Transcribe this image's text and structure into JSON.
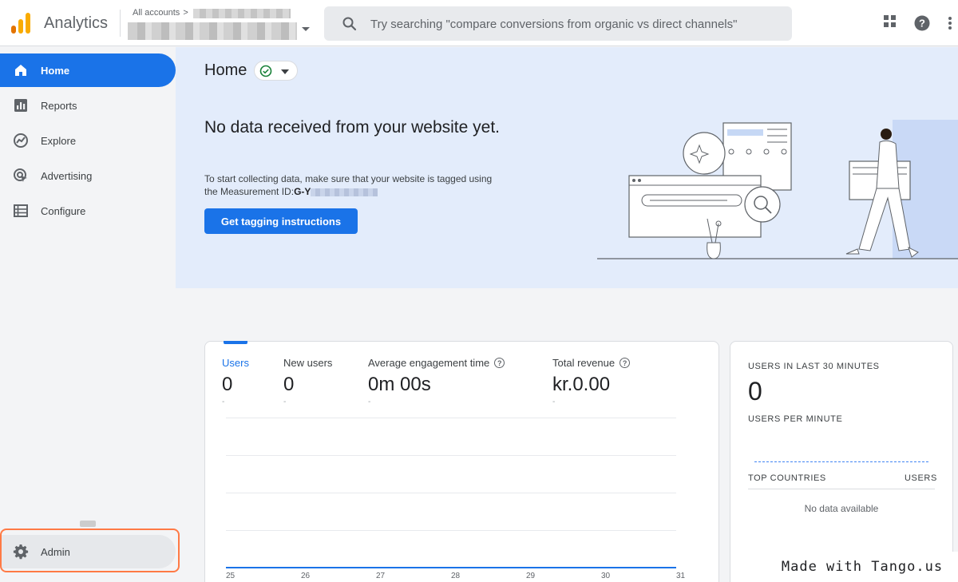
{
  "header": {
    "brand": "Analytics",
    "account_label": "All accounts",
    "account_chevron": ">",
    "search_placeholder": "Try searching \"compare conversions from organic vs direct channels\"",
    "icons": [
      "apps-grid-icon",
      "help-icon",
      "more-vert-icon"
    ]
  },
  "sidebar": {
    "items": [
      {
        "label": "Home",
        "icon": "home-icon",
        "active": true
      },
      {
        "label": "Reports",
        "icon": "bar-chart-icon",
        "active": false
      },
      {
        "label": "Explore",
        "icon": "explore-icon",
        "active": false
      },
      {
        "label": "Advertising",
        "icon": "advertising-icon",
        "active": false
      },
      {
        "label": "Configure",
        "icon": "configure-icon",
        "active": false
      }
    ],
    "admin_label": "Admin"
  },
  "hero": {
    "title": "Home",
    "heading": "No data received from your website yet.",
    "body_prefix": "To start collecting data, make sure that your website is tagged using the Measurement ID:",
    "measurement_id": "G-Y",
    "button": "Get tagging instructions"
  },
  "metrics": [
    {
      "label": "Users",
      "value": "0",
      "delta": "-",
      "help": false
    },
    {
      "label": "New users",
      "value": "0",
      "delta": "-",
      "help": false
    },
    {
      "label": "Average engagement time",
      "value": "0m 00s",
      "delta": "-",
      "help": true
    },
    {
      "label": "Total revenue",
      "value": "kr.0.00",
      "delta": "-",
      "help": true
    }
  ],
  "chart_data": {
    "type": "line",
    "x": [
      "25",
      "26",
      "27",
      "28",
      "29",
      "30",
      "31"
    ],
    "series": [
      {
        "values": [
          0,
          0,
          0,
          0,
          0,
          0,
          0
        ]
      }
    ]
  },
  "realtime": {
    "users_caption": "USERS IN LAST 30 MINUTES",
    "users_value": "0",
    "per_minute_caption": "USERS PER MINUTE",
    "countries_caption": "TOP COUNTRIES",
    "users_col": "USERS",
    "no_data": "No data available"
  },
  "watermark": "Made with Tango.us",
  "colors": {
    "accent": "#1a73e8",
    "hero_bg": "#e3ecfb",
    "admin_highlight": "#ff7a45"
  }
}
